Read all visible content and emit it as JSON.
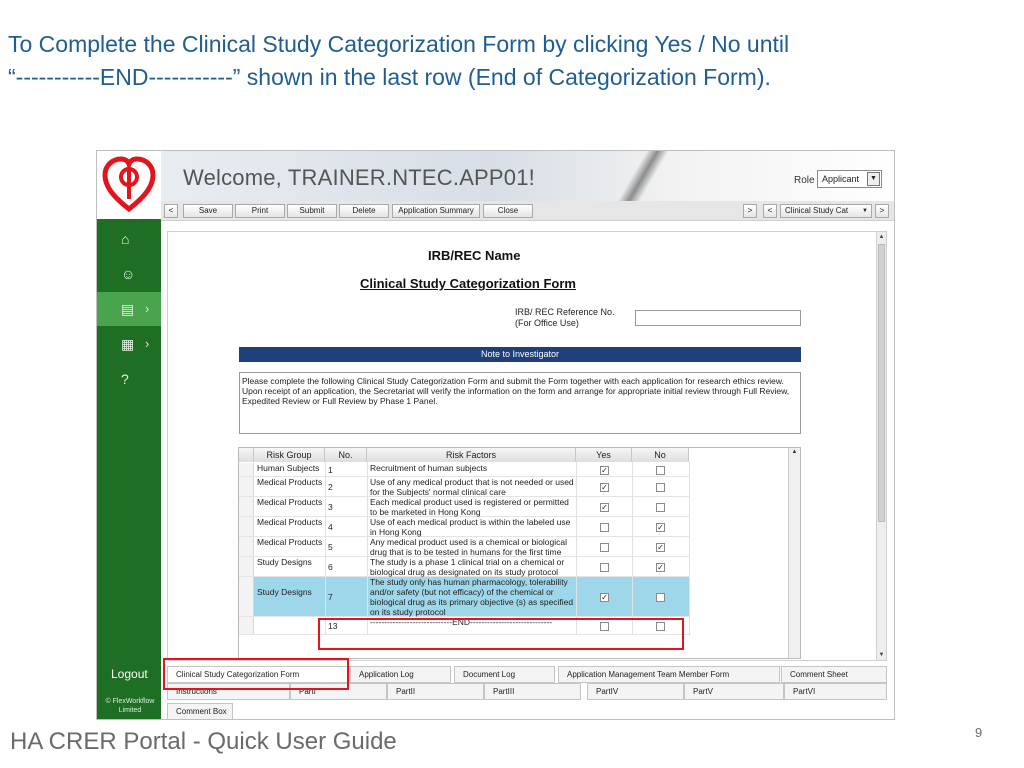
{
  "slide": {
    "title_line1": "To Complete the Clinical Study Categorization Form by clicking Yes / No until",
    "title_line2": "“-----------END-----------” shown in the last row (End of Categorization Form).",
    "footer": "HA CRER Portal - Quick User Guide",
    "page_number": "9"
  },
  "app": {
    "welcome": "Welcome, TRAINER.NTEC.APP01!",
    "role_label": "Role",
    "role_value": "Applicant",
    "toolbar": {
      "prev": "<",
      "save": "Save",
      "print": "Print",
      "submit": "Submit",
      "delete": "Delete",
      "app_summary": "Application Summary",
      "close": "Close",
      "nav_next": ">",
      "nav_prev": "<",
      "form_select": "Clinical Study Cat",
      "form_next": ">"
    },
    "sidebar": {
      "logout": "Logout",
      "copyright": "© FlexWorkflow Limited"
    },
    "form": {
      "irb_name": "IRB/REC Name",
      "title": "Clinical Study Categorization Form",
      "ref_label_1": "IRB/ REC Reference No.",
      "ref_label_2": "(For Office Use)",
      "ref_value": "",
      "note_header": "Note to Investigator",
      "note_text": "Please complete the following Clinical Study Categorization Form and submit the Form together with each application for research ethics review.  Upon receipt of an application, the Secretariat will verify the information on the form and arrange for appropriate initial review through Full Review, Expedited Review or Full Review by Phase 1 Panel."
    },
    "grid": {
      "headers": {
        "risk_group": "Risk Group",
        "no": "No.",
        "risk_factors": "Risk Factors",
        "yes": "Yes",
        "no_col": "No"
      },
      "rows": [
        {
          "group": "Human Subjects",
          "no": "1",
          "factor": "Recruitment of human subjects",
          "yes": true,
          "no_val": false
        },
        {
          "group": "Medical Products",
          "no": "2",
          "factor": "Use of any medical product that is not needed or used for the Subjects' normal clinical care",
          "yes": true,
          "no_val": false
        },
        {
          "group": "Medical Products",
          "no": "3",
          "factor": "Each medical product used is registered or permitted to be marketed in Hong Kong",
          "yes": true,
          "no_val": false
        },
        {
          "group": "Medical Products",
          "no": "4",
          "factor": "Use of each medical product is within the labeled use in Hong Kong",
          "yes": false,
          "no_val": true
        },
        {
          "group": "Medical Products",
          "no": "5",
          "factor": "Any medical product used is a chemical or biological drug that is to be tested in humans for the first time",
          "yes": false,
          "no_val": true
        },
        {
          "group": "Study Designs",
          "no": "6",
          "factor": "The study is a phase 1 clinical trial on a chemical or biological drug as designated on its study protocol",
          "yes": false,
          "no_val": true
        },
        {
          "group": "Study Designs",
          "no": "7",
          "factor": "The study only has human pharmacology, tolerability and/or safety (but not efficacy) of the chemical or biological drug as its primary objective (s) as specified on its study protocol",
          "yes": true,
          "no_val": false
        },
        {
          "group": "",
          "no": "13",
          "factor": "-----------------------------END-----------------------------",
          "yes": false,
          "no_val": false
        }
      ]
    },
    "tabs_row1": [
      "Clinical Study Categorization Form",
      "Application Log",
      "Document Log",
      "Application Management Team Member Form",
      "Comment Sheet"
    ],
    "tabs_row2": [
      "Instructions",
      "PartI",
      "PartII",
      "PartIII",
      "PartIV",
      "PartV",
      "PartVI"
    ],
    "tabs_row3": [
      "Comment Box"
    ]
  },
  "colors": {
    "title_blue": "#1f5d92",
    "sidebar_green": "#1e6e23",
    "sidebar_active": "#4aa34d",
    "note_bar": "#1f3f7a",
    "highlight_red": "#e2141d",
    "row_selected": "#9ed7ea"
  }
}
